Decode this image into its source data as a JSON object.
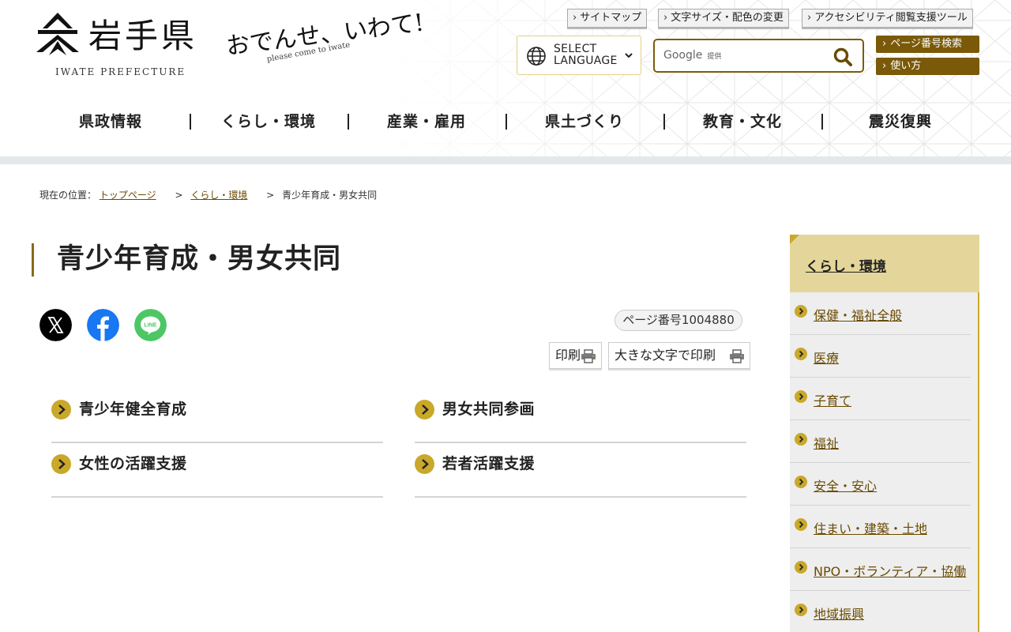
{
  "header": {
    "logo_name": "岩手県",
    "logo_en": "IWATE PREFECTURE",
    "tagline": "おでんせ、いわて!",
    "tagline_en": "please come to iwate",
    "util_links": [
      "サイトマップ",
      "文字サイズ・配色の変更",
      "アクセシビリティ閲覧支援ツール"
    ],
    "language_label": "SELECT LANGUAGE",
    "search_provider": "Google",
    "search_provided": "提供",
    "page_number_search": "ページ番号検索",
    "how_to_use": "使い方"
  },
  "gnav": [
    "県政情報",
    "くらし・環境",
    "産業・雇用",
    "県土づくり",
    "教育・文化",
    "震災復興"
  ],
  "breadcrumb": {
    "prefix": "現在の位置：",
    "items": [
      "トップページ",
      "くらし・環境"
    ],
    "current": "青少年育成・男女共同"
  },
  "main": {
    "title": "青少年育成・男女共同",
    "page_number": "ページ番号1004880",
    "print_label": "印刷",
    "print_large_label": "大きな文字で印刷",
    "links": [
      "青少年健全育成",
      "男女共同参画",
      "女性の活躍支援",
      "若者活躍支援"
    ]
  },
  "sns": [
    "x-icon",
    "facebook-icon",
    "line-icon"
  ],
  "side": {
    "title": "くらし・環境",
    "items": [
      "保健・福祉全般",
      "医療",
      "子育て",
      "福祉",
      "安全・安心",
      "住まい・建築・土地",
      "NPO・ボランティア・協働",
      "地域振興"
    ]
  },
  "colors": {
    "accent_gold": "#c9a82a",
    "dark_gold": "#7a5a08",
    "link_brown": "#6a4a00",
    "side_head_bg": "#e4d69a",
    "line_green": "#06c755",
    "facebook_blue": "#1877f2"
  }
}
